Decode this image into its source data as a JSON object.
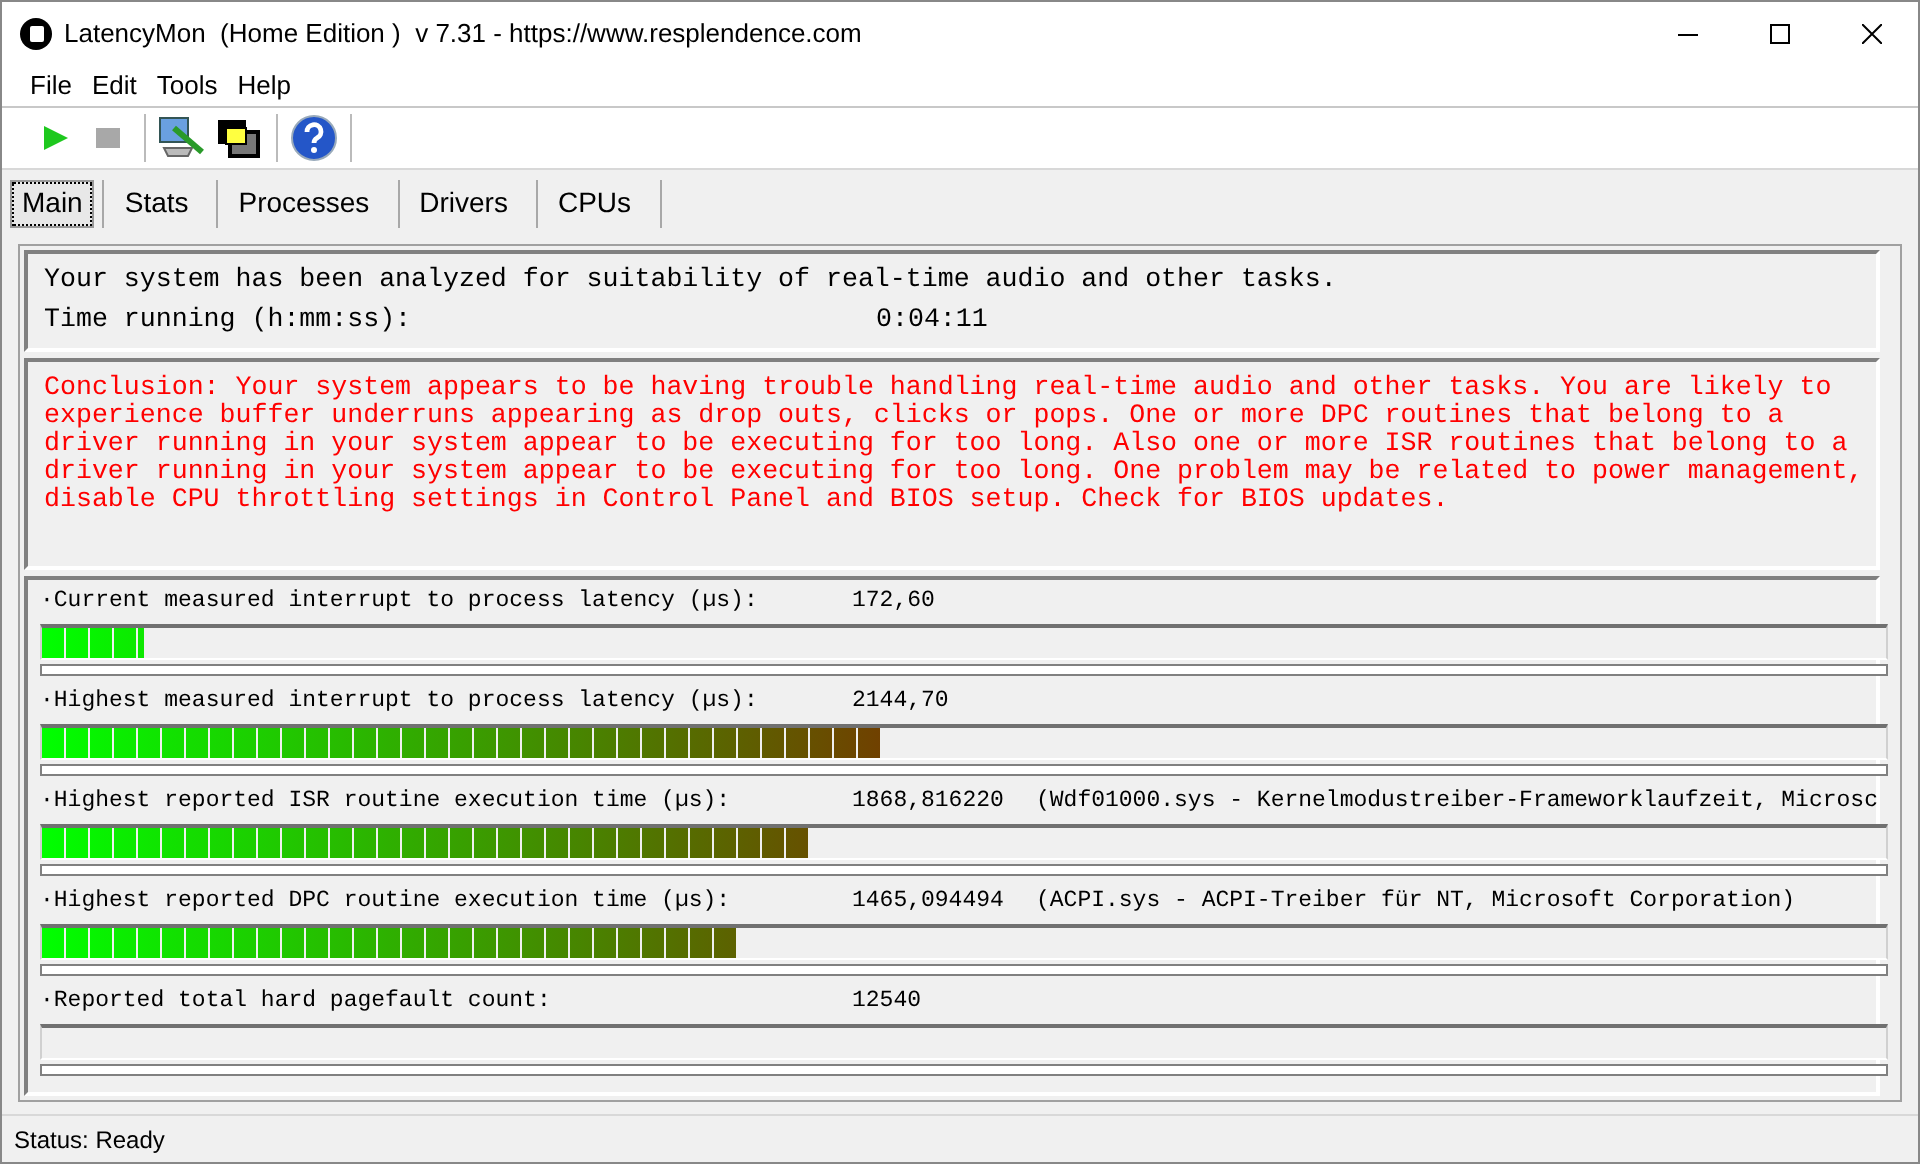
{
  "window": {
    "title": "LatencyMon  (Home Edition )  v 7.31 - https://www.resplendence.com"
  },
  "menu": [
    "File",
    "Edit",
    "Tools",
    "Help"
  ],
  "tabs": [
    {
      "label": "Main",
      "selected": true
    },
    {
      "label": "Stats",
      "selected": false
    },
    {
      "label": "Processes",
      "selected": false
    },
    {
      "label": "Drivers",
      "selected": false
    },
    {
      "label": "CPUs",
      "selected": false
    }
  ],
  "summary": {
    "text": "Your system has been analyzed for suitability of real-time audio and other tasks.",
    "time_label": "Time running (h:mm:ss):",
    "time_value": "0:04:11"
  },
  "conclusion_lines": [
    "Conclusion: Your system appears to be having trouble handling real-time audio and other tasks. You are likely to",
    "experience buffer underruns appearing as drop outs, clicks or pops. One or more DPC routines that belong to a",
    "driver running in your system appear to be executing for too long. Also one or more ISR routines that belong to a",
    "driver running in your system appear to be executing for too long. One problem may be related to power management,",
    "disable CPU throttling settings in Control Panel and BIOS setup. Check for BIOS updates."
  ],
  "meters": [
    {
      "label": "·Current measured interrupt to process latency (µs):",
      "value": "172,60",
      "level": 0.055
    },
    {
      "label": "·Highest measured interrupt to process latency (µs):",
      "value": "2144,70",
      "level": 0.455
    },
    {
      "label": "·Highest reported ISR routine execution time (µs):",
      "value": "1868,816220",
      "detail": "(Wdf01000.sys - Kernelmodustreiber-Frameworklaufzeit, Microsc",
      "level": 0.415
    },
    {
      "label": "·Highest reported DPC routine execution time (µs):",
      "value": "1465,094494",
      "detail": "(ACPI.sys - ACPI-Treiber für NT, Microsoft Corporation)",
      "level": 0.376
    },
    {
      "label": "·Reported total hard pagefault count:",
      "value": "12540",
      "level": 0
    }
  ],
  "status_bar": "Status: Ready"
}
